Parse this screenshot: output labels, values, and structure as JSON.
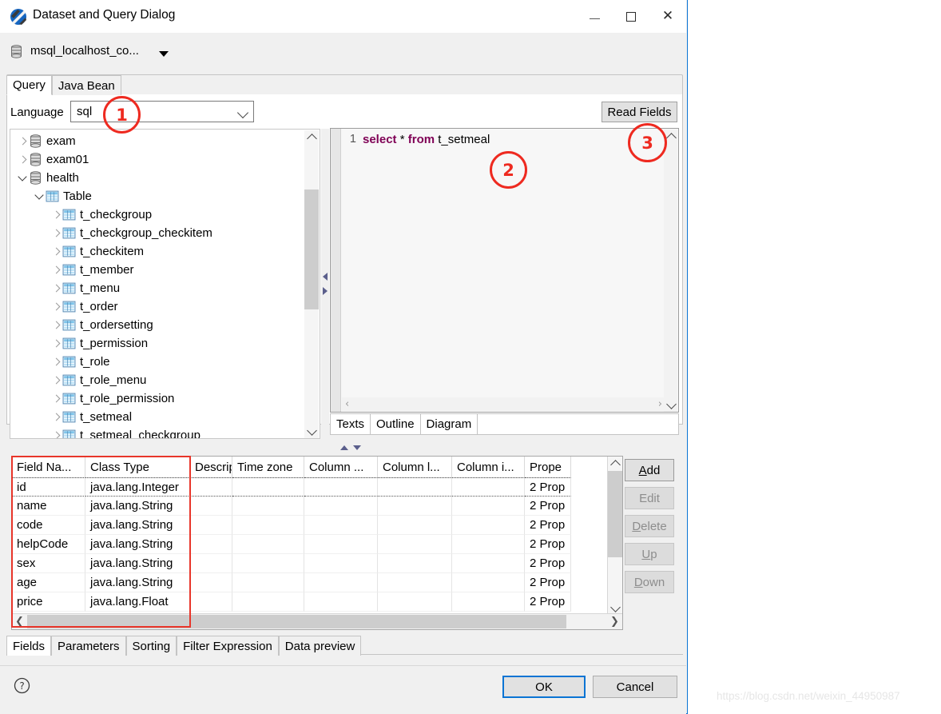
{
  "window": {
    "title": "Dataset and Query Dialog",
    "icon": "app-icon",
    "minimize": "minimize-icon",
    "maximize": "maximize-icon",
    "close": "close-icon"
  },
  "connection": {
    "name": "msql_localhost_co...",
    "icon": "database-icon"
  },
  "tabs": [
    {
      "label": "Query",
      "active": true
    },
    {
      "label": "Java Bean",
      "active": false
    }
  ],
  "language": {
    "label": "Language",
    "value": "sql",
    "placeholder": "sql"
  },
  "read_fields_button": "Read Fields",
  "tree": [
    {
      "label": "exam",
      "indent": 0,
      "expanded": false,
      "icon": "database-icon"
    },
    {
      "label": "exam01",
      "indent": 0,
      "expanded": false,
      "icon": "database-icon"
    },
    {
      "label": "health",
      "indent": 0,
      "expanded": true,
      "icon": "database-icon"
    },
    {
      "label": "Table",
      "indent": 1,
      "expanded": true,
      "icon": "table-icon"
    },
    {
      "label": "t_checkgroup",
      "indent": 2,
      "expanded": false,
      "icon": "table-icon"
    },
    {
      "label": "t_checkgroup_checkitem",
      "indent": 2,
      "expanded": false,
      "icon": "table-icon"
    },
    {
      "label": "t_checkitem",
      "indent": 2,
      "expanded": false,
      "icon": "table-icon"
    },
    {
      "label": "t_member",
      "indent": 2,
      "expanded": false,
      "icon": "table-icon"
    },
    {
      "label": "t_menu",
      "indent": 2,
      "expanded": false,
      "icon": "table-icon"
    },
    {
      "label": "t_order",
      "indent": 2,
      "expanded": false,
      "icon": "table-icon"
    },
    {
      "label": "t_ordersetting",
      "indent": 2,
      "expanded": false,
      "icon": "table-icon"
    },
    {
      "label": "t_permission",
      "indent": 2,
      "expanded": false,
      "icon": "table-icon"
    },
    {
      "label": "t_role",
      "indent": 2,
      "expanded": false,
      "icon": "table-icon"
    },
    {
      "label": "t_role_menu",
      "indent": 2,
      "expanded": false,
      "icon": "table-icon"
    },
    {
      "label": "t_role_permission",
      "indent": 2,
      "expanded": false,
      "icon": "table-icon"
    },
    {
      "label": "t_setmeal",
      "indent": 2,
      "expanded": false,
      "icon": "table-icon"
    },
    {
      "label": "t_setmeal_checkgroup",
      "indent": 2,
      "expanded": false,
      "icon": "table-icon"
    }
  ],
  "editor": {
    "line_number": "1",
    "keyword1": "select",
    "star": " * ",
    "keyword2": "from",
    "rest": " t_setmeal",
    "full_text": "select * from t_setmeal",
    "keyword_color": "#7f0055",
    "tabs": [
      {
        "label": "Texts",
        "active": true
      },
      {
        "label": "Outline",
        "active": false
      },
      {
        "label": "Diagram",
        "active": false
      }
    ]
  },
  "fields_table": {
    "columns": [
      {
        "label": "Field Na...",
        "width": 92
      },
      {
        "label": "Class Type",
        "width": 131
      },
      {
        "label": "Descripti...",
        "width": 53
      },
      {
        "label": "Time zone",
        "width": 90
      },
      {
        "label": "Column ...",
        "width": 92
      },
      {
        "label": "Column l...",
        "width": 93
      },
      {
        "label": "Column i...",
        "width": 91
      },
      {
        "label": "Prope",
        "width": 58
      }
    ],
    "rows": [
      {
        "field": "id",
        "type": "java.lang.Integer",
        "description": "",
        "timezone": "",
        "col_a": "",
        "col_l": "",
        "col_i": "",
        "properties": "2 Prop",
        "selected": true
      },
      {
        "field": "name",
        "type": "java.lang.String",
        "description": "",
        "timezone": "",
        "col_a": "",
        "col_l": "",
        "col_i": "",
        "properties": "2 Prop",
        "selected": false
      },
      {
        "field": "code",
        "type": "java.lang.String",
        "description": "",
        "timezone": "",
        "col_a": "",
        "col_l": "",
        "col_i": "",
        "properties": "2 Prop",
        "selected": false
      },
      {
        "field": "helpCode",
        "type": "java.lang.String",
        "description": "",
        "timezone": "",
        "col_a": "",
        "col_l": "",
        "col_i": "",
        "properties": "2 Prop",
        "selected": false
      },
      {
        "field": "sex",
        "type": "java.lang.String",
        "description": "",
        "timezone": "",
        "col_a": "",
        "col_l": "",
        "col_i": "",
        "properties": "2 Prop",
        "selected": false
      },
      {
        "field": "age",
        "type": "java.lang.String",
        "description": "",
        "timezone": "",
        "col_a": "",
        "col_l": "",
        "col_i": "",
        "properties": "2 Prop",
        "selected": false
      },
      {
        "field": "price",
        "type": "java.lang.Float",
        "description": "",
        "timezone": "",
        "col_a": "",
        "col_l": "",
        "col_i": "",
        "properties": "2 Prop",
        "selected": false
      }
    ]
  },
  "side_buttons": [
    {
      "label": "Add",
      "mnemonic": "A",
      "enabled": true
    },
    {
      "label": "Edit",
      "mnemonic": "",
      "enabled": false
    },
    {
      "label": "Delete",
      "mnemonic": "D",
      "enabled": false
    },
    {
      "label": "Up",
      "mnemonic": "U",
      "enabled": false
    },
    {
      "label": "Down",
      "mnemonic": "D",
      "enabled": false
    }
  ],
  "bottom_tabs": [
    {
      "label": "Fields",
      "active": true
    },
    {
      "label": "Parameters",
      "active": false
    },
    {
      "label": "Sorting",
      "active": false
    },
    {
      "label": "Filter Expression",
      "active": false
    },
    {
      "label": "Data preview",
      "active": false
    }
  ],
  "footer": {
    "help": "help-icon",
    "ok": "OK",
    "cancel": "Cancel"
  },
  "annotations": [
    {
      "label": "1",
      "color": "#ee2a20"
    },
    {
      "label": "2",
      "color": "#ee2a20"
    },
    {
      "label": "3",
      "color": "#ee2a20"
    }
  ],
  "watermark": "https://blog.csdn.net/weixin_44950987"
}
